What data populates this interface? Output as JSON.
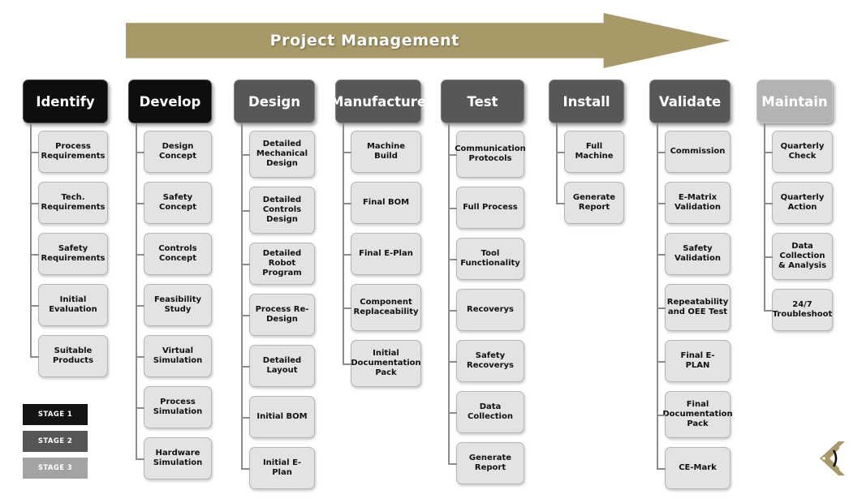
{
  "banner": {
    "title": "Project Management",
    "color": "#a89968"
  },
  "stage_colors": {
    "stage1": "#0e0e0e",
    "stage2": "#575757",
    "stage3": "#b3b3b3",
    "node": "#e3e3e3"
  },
  "columns": [
    {
      "header": "Identify",
      "stage": "stage1",
      "items": [
        "Process Requirements",
        "Tech. Requirements",
        "Safety Requirements",
        "Initial Evaluation",
        "Suitable Products"
      ]
    },
    {
      "header": "Develop",
      "stage": "stage1",
      "items": [
        "Design Concept",
        "Safety Concept",
        "Controls Concept",
        "Feasibility Study",
        "Virtual Simulation",
        "Process Simulation",
        "Hardware Simulation"
      ]
    },
    {
      "header": "Design",
      "stage": "stage2",
      "items": [
        "Detailed Mechanical Design",
        "Detailed Controls Design",
        "Detailed Robot Program",
        "Process Re-Design",
        "Detailed Layout",
        "Initial BOM",
        "Initial E-Plan"
      ]
    },
    {
      "header": "Manufacture",
      "stage": "stage2",
      "items": [
        "Machine Build",
        "Final BOM",
        "Final E-Plan",
        "Component Replaceability",
        "Initial Documentation Pack"
      ]
    },
    {
      "header": "Test",
      "stage": "stage2",
      "items": [
        "Communication Protocols",
        "Full Process",
        "Tool Functionality",
        "Recoverys",
        "Safety Recoverys",
        "Data Collection",
        "Generate Report"
      ]
    },
    {
      "header": "Install",
      "stage": "stage2",
      "items": [
        "Full Machine",
        "Generate Report"
      ]
    },
    {
      "header": "Validate",
      "stage": "stage2",
      "items": [
        "Commission",
        "E-Matrix Validation",
        "Safety Validation",
        "Repeatability and OEE Test",
        "Final E-PLAN",
        "Final Documentation Pack",
        "CE-Mark"
      ]
    },
    {
      "header": "Maintain",
      "stage": "stage3",
      "items": [
        "Quarterly Check",
        "Quarterly Action",
        "Data Collection & Analysis",
        "24/7 Troubleshoot"
      ]
    }
  ],
  "legend": [
    {
      "label": "STAGE 1",
      "stage": "stage1"
    },
    {
      "label": "STAGE 2",
      "stage": "stage2"
    },
    {
      "label": "STAGE 3",
      "stage": "stage3"
    }
  ],
  "logo": {
    "name": "chevron-logo",
    "color": "#a89968"
  }
}
